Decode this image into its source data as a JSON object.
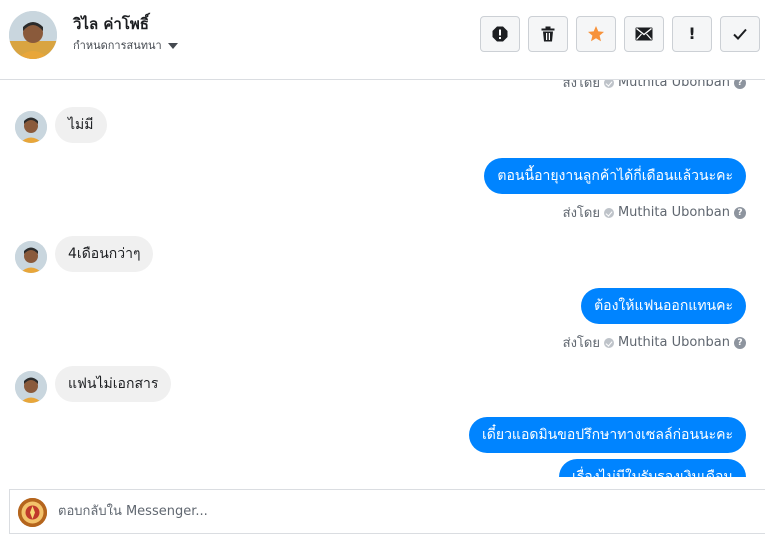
{
  "header": {
    "contact_name": "วิไล ค่าโพธิ์",
    "assign_label": "กำหนดการสนทนา",
    "actions": [
      {
        "icon": "spam-report-icon",
        "name": "mark-spam-button"
      },
      {
        "icon": "trash-icon",
        "name": "delete-button"
      },
      {
        "icon": "star-icon",
        "name": "star-button"
      },
      {
        "icon": "envelope-icon",
        "name": "mark-unread-button"
      },
      {
        "icon": "exclamation-icon",
        "name": "follow-up-button"
      },
      {
        "icon": "checkmark-icon",
        "name": "mark-done-button"
      }
    ]
  },
  "colors": {
    "outgoing_bubble": "#0084ff",
    "incoming_bubble": "#f0f0f0",
    "star": "#f7923a"
  },
  "thread": {
    "sent_prefix": "ส่งโดย",
    "sender_name": "Muthita Ubonban",
    "messages": [
      {
        "direction": "out-meta"
      },
      {
        "direction": "in",
        "text": "ไม่มี"
      },
      {
        "direction": "out",
        "text": "ตอนนี้อายุงานลูกค้าได้กี่เดือนแล้วนะคะ"
      },
      {
        "direction": "in",
        "text": "4เดือนกว่าๆ"
      },
      {
        "direction": "out",
        "text": "ต้องให้แฟนออกแทนคะ"
      },
      {
        "direction": "in",
        "text": "แฟนไม่เอกสาร"
      },
      {
        "direction": "out",
        "text": "เดี๋ยวแอดมินขอปรึกษาทางเซลล์ก่อนนะคะ"
      },
      {
        "direction": "out",
        "text": "เรื่องไม่มีใบรับรองเงินเดือน"
      }
    ]
  },
  "composer": {
    "placeholder": "ตอบกลับใน Messenger..."
  }
}
